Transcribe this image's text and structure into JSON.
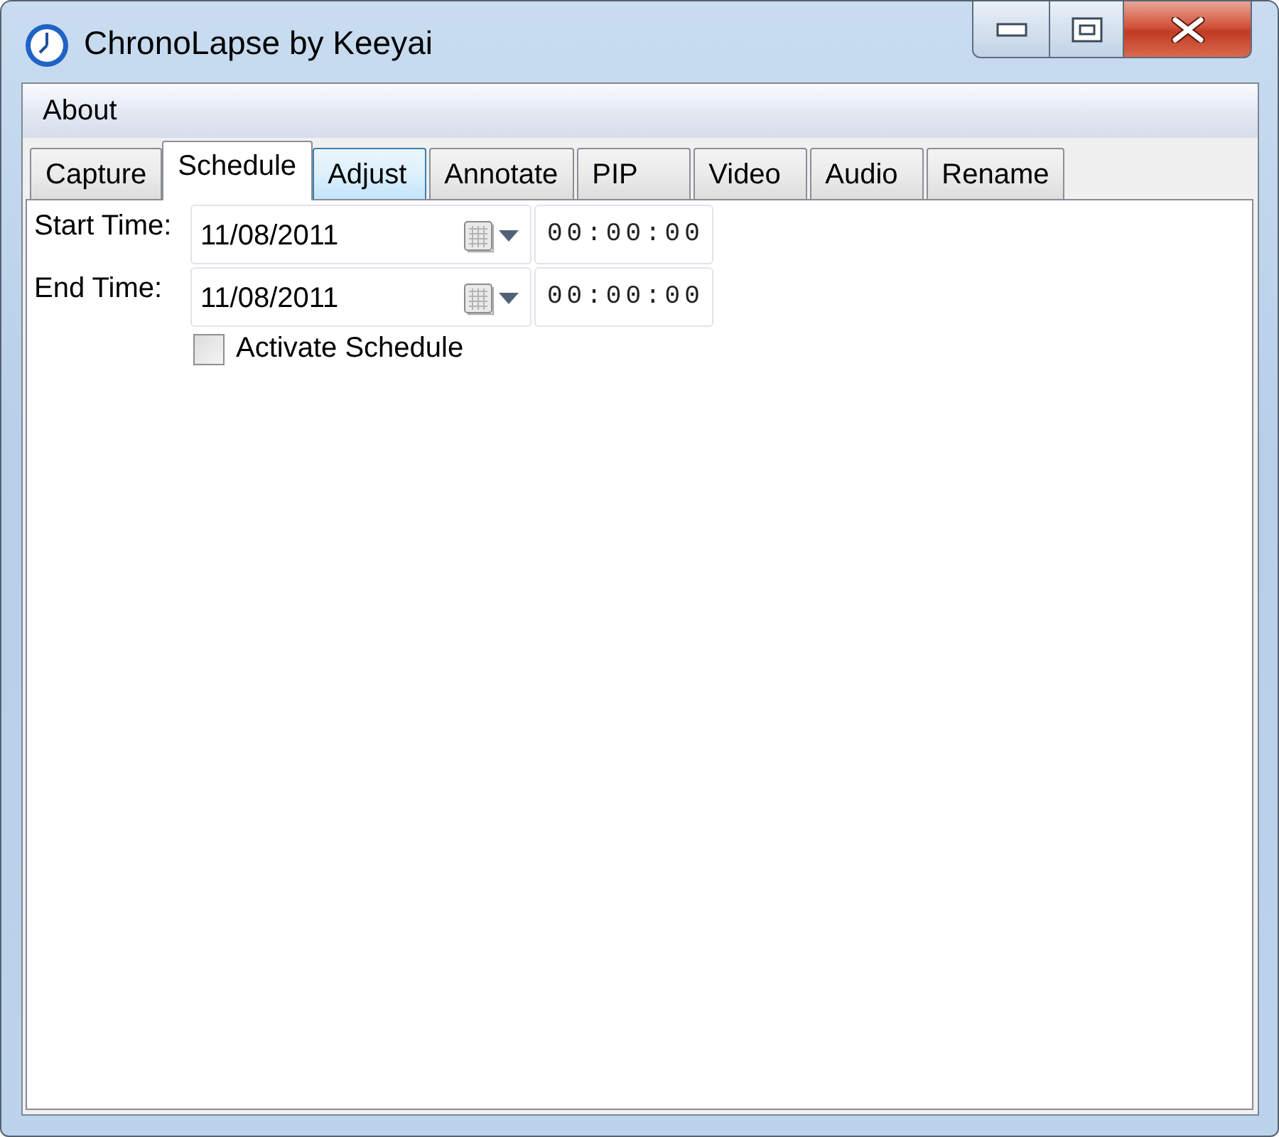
{
  "window": {
    "title": "ChronoLapse by Keeyai"
  },
  "menu": [
    {
      "label": "About"
    }
  ],
  "tabs": [
    {
      "label": "Capture",
      "selected": false,
      "hovered": false
    },
    {
      "label": "Schedule",
      "selected": true,
      "hovered": false
    },
    {
      "label": "Adjust",
      "selected": false,
      "hovered": true
    },
    {
      "label": "Annotate",
      "selected": false,
      "hovered": false
    },
    {
      "label": "PIP",
      "selected": false,
      "hovered": false
    },
    {
      "label": "Video",
      "selected": false,
      "hovered": false
    },
    {
      "label": "Audio",
      "selected": false,
      "hovered": false
    },
    {
      "label": "Rename",
      "selected": false,
      "hovered": false
    }
  ],
  "schedule": {
    "rows": [
      {
        "label": "Start Time:",
        "date": "11/08/2011",
        "time": "00:00:00"
      },
      {
        "label": "End Time:",
        "date": "11/08/2011",
        "time": "00:00:00"
      }
    ],
    "activate": {
      "label": "Activate Schedule",
      "checked": false
    }
  }
}
